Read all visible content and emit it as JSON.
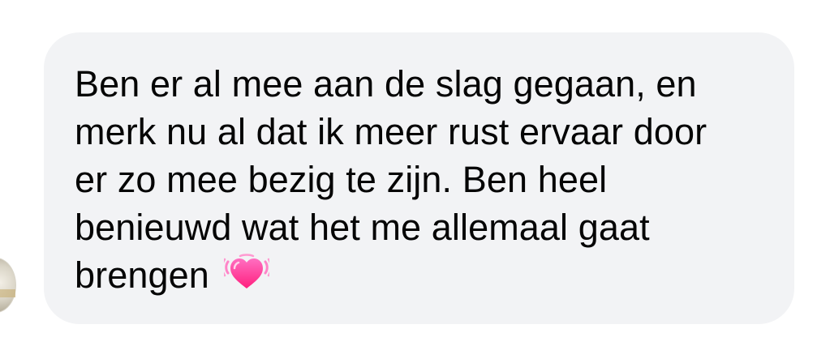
{
  "message": {
    "lines": [
      "Ben er al mee aan de slag gegaan, en",
      "merk nu al dat ik meer rust ervaar door",
      "er zo mee bezig te zijn. Ben heel",
      "benieuwd wat het me allemaal gaat",
      "brengen"
    ],
    "emoji": "beating-heart-emoji"
  },
  "colors": {
    "bubble_background": "#f2f3f5",
    "text": "#050505",
    "heart": "#ff3b9a"
  }
}
